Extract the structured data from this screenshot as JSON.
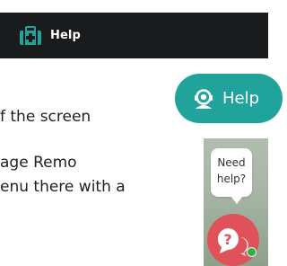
{
  "topbar": {
    "icon": "medical-kit-icon",
    "label": "Help"
  },
  "body_text": {
    "line1": "f the screen",
    "line2": "age Remo",
    "line3": "enu there with a"
  },
  "help_button": {
    "icon": "headset-icon",
    "label": "Help"
  },
  "chat_widget": {
    "bubble_line1": "Need",
    "bubble_line2": "help?",
    "icon": "chat-question-icon",
    "status": "online"
  },
  "colors": {
    "topbar_bg": "#1a1b1d",
    "accent_teal": "#20a39a",
    "chat_red": "#e0525a",
    "status_green": "#2fb14a"
  }
}
